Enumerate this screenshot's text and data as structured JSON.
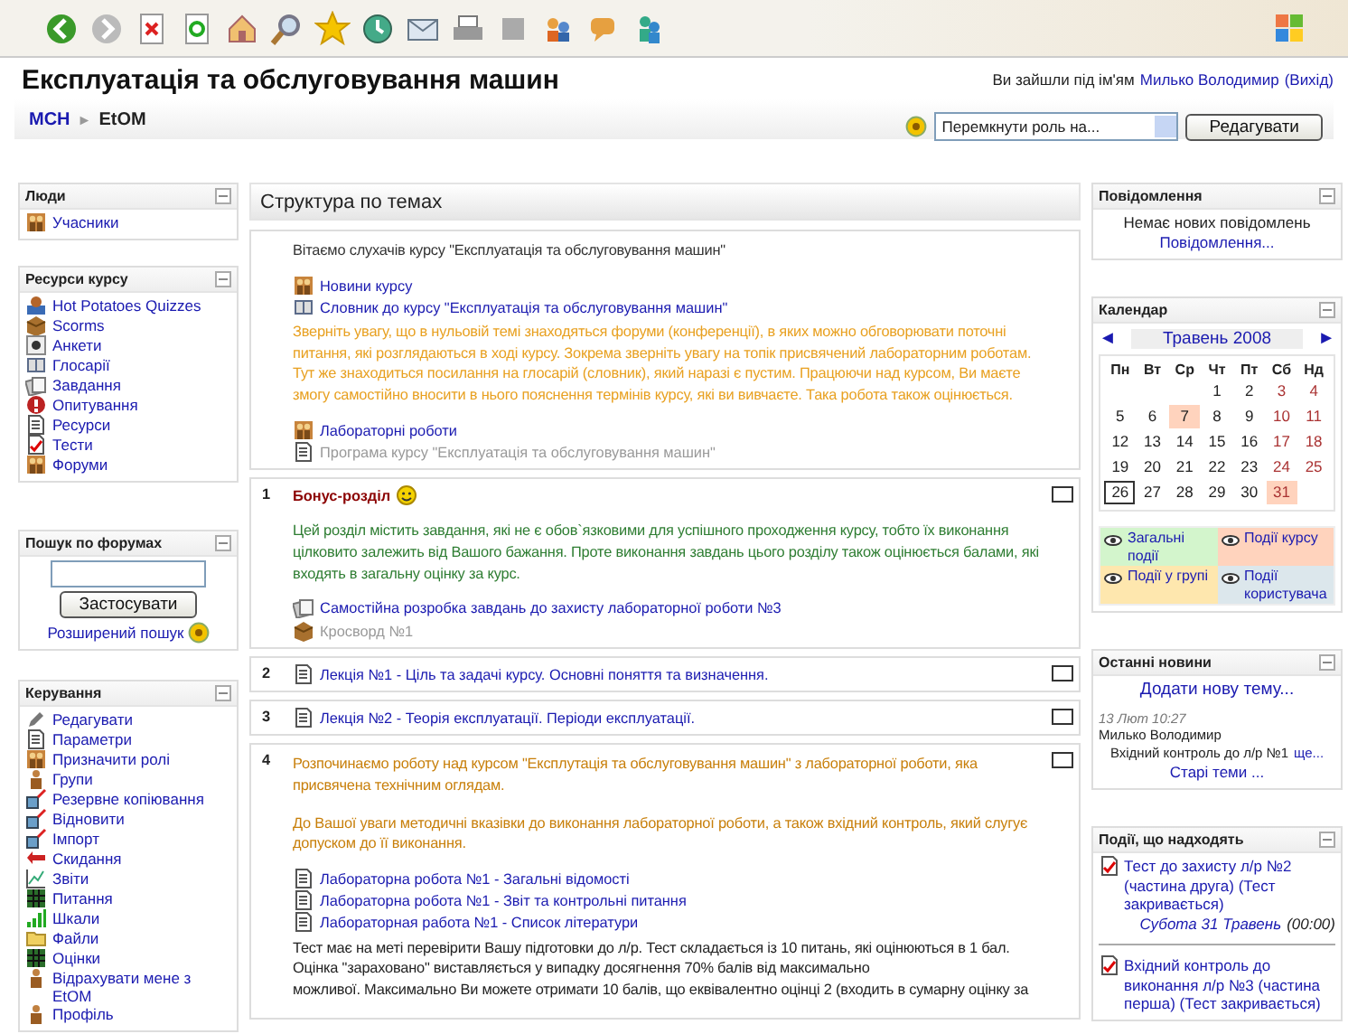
{
  "header": {
    "title": "Експлуатація та обслуговування машин",
    "login_text": "Ви зайшли під ім'ям",
    "user_link": "Милько Володимир",
    "logout_link": "(Вихід)"
  },
  "breadcrumb": {
    "items": [
      "МСН",
      "EtOM"
    ],
    "separator": "►"
  },
  "role_select": {
    "placeholder": "Перемкнути роль на..."
  },
  "edit_button": "Редагувати",
  "left_blocks": [
    {
      "title": "Люди",
      "kind": "links",
      "items": [
        {
          "label": "Учасники",
          "kind": "participants"
        }
      ]
    },
    {
      "title": "Ресурси курсу",
      "kind": "links",
      "items": [
        {
          "label": "Hot Potatoes Quizzes",
          "kind": "quiz"
        },
        {
          "label": "Scorms",
          "kind": "scorm"
        },
        {
          "label": "Анкети",
          "kind": "survey"
        },
        {
          "label": "Глосарії",
          "kind": "glossary"
        },
        {
          "label": "Завдання",
          "kind": "assignment"
        },
        {
          "label": "Опитування",
          "kind": "poll"
        },
        {
          "label": "Ресурси",
          "kind": "resource"
        },
        {
          "label": "Тести",
          "kind": "test"
        },
        {
          "label": "Форуми",
          "kind": "forum"
        }
      ]
    },
    {
      "title": "Пошук по форумах",
      "kind": "search",
      "button": "Застосувати",
      "link": "Розширений пошук"
    },
    {
      "title": "Керування",
      "kind": "links",
      "items": [
        {
          "label": "Редагувати",
          "kind": "edit"
        },
        {
          "label": "Параметри",
          "kind": "settings"
        },
        {
          "label": "Призначити ролі",
          "kind": "roles"
        },
        {
          "label": "Групи",
          "kind": "groups"
        },
        {
          "label": "Резервне копіювання",
          "kind": "backup"
        },
        {
          "label": "Відновити",
          "kind": "backup"
        },
        {
          "label": "Імпорт",
          "kind": "backup"
        },
        {
          "label": "Скидання",
          "kind": "reset"
        },
        {
          "label": "Звіти",
          "kind": "reports"
        },
        {
          "label": "Питання",
          "kind": "questions"
        },
        {
          "label": "Шкали",
          "kind": "scales"
        },
        {
          "label": "Файли",
          "kind": "files"
        },
        {
          "label": "Оцінки",
          "kind": "questions"
        },
        {
          "label": "Відрахувати мене з EtOM",
          "kind": "unenrol"
        },
        {
          "label": "Профіль",
          "kind": "unenrol"
        }
      ]
    }
  ],
  "center": {
    "title": "Структура по темах",
    "sections": [
      {
        "toggle": false,
        "content": [
          {
            "kind": "text",
            "color": "#333333",
            "text": "Вітаємо слухачів курсу \"Експлуатація та обслуговування машин\""
          },
          {
            "kind": "forum",
            "label": "Новини курсу",
            "dimmed": false
          },
          {
            "kind": "glossary",
            "label": "Словник до курсу \"Експлуатація та обслуговування машин\"",
            "dimmed": false
          },
          {
            "kind": "text",
            "color": "#e8a020",
            "text": "Зверніть увагу, що в нульовій темі знаходяться форуми (конференції), в яких можно обговорювати поточні питання, які розглядаються в ході курсу. Зокрема зверніть увагу на топік присвячений лабораторним роботам. Тут же знаходиться посилання на глосарій (словник), який наразі є пустим. Працюючи над курсом, Ви маєте змогу самостійно вносити в нього пояснення термінів курсу, які ви вивчаєте. Така робота також оцінюється."
          },
          {
            "kind": "forum",
            "label": "Лабораторні роботи",
            "dimmed": false
          },
          {
            "kind": "resource",
            "label": "Програма курсу \"Експлуатація та обслуговування машин\"",
            "dimmed": true
          }
        ]
      },
      {
        "number": "1",
        "toggle": true,
        "content": [
          {
            "kind": "title",
            "text": "Бонус-розділ"
          },
          {
            "kind": "text",
            "color": "#2e7d32",
            "text": "Цей розділ містить завдання, які не є обов`язковими для успішного проходження курсу, тобто їх виконання цілковито залежить від Вашого бажання. Проте виконання завдань цього розділу також оцінюється балами, які входять в загальну оцінку за курс."
          },
          {
            "kind": "assignment",
            "label": "Самостійна розробка завдань до захисту лабораторної роботи №3",
            "dimmed": false
          },
          {
            "kind": "scorm",
            "label": "Кросворд №1",
            "dimmed": true
          }
        ]
      },
      {
        "number": "2",
        "toggle": true,
        "content": [
          {
            "kind": "resource",
            "label": "Лекція №1 - Ціль та задачі курсу. Основні поняття та визначення.",
            "dimmed": false
          }
        ]
      },
      {
        "number": "3",
        "toggle": true,
        "content": [
          {
            "kind": "resource",
            "label": "Лекція №2 - Теорія експлуатації. Періоди експлуатації.",
            "dimmed": false
          }
        ]
      },
      {
        "number": "4",
        "toggle": true,
        "content": [
          {
            "kind": "text",
            "color": "#c87f0a",
            "text": "Розпочинаємо роботу над курсом \"Експлутація та обслуговування машин\" з лабораторної роботи, яка присвячена технічним оглядам."
          },
          {
            "kind": "text",
            "color": "#c87f0a",
            "text": "До Вашої уваги методичні вказівки до виконання лабораторної роботи, а також вхідний контроль, який слугує допуском до її виконання."
          },
          {
            "kind": "resource",
            "label": "Лабораторна робота №1 - Загальні відомості",
            "dimmed": false
          },
          {
            "kind": "resource",
            "label": "Лабораторна робота №1 - Звіт та контрольні питання",
            "dimmed": false
          },
          {
            "kind": "resource",
            "label": "Лабораторная работа №1 - Список літератури",
            "dimmed": false
          },
          {
            "kind": "text",
            "color": "#222222",
            "text": "Тест має на меті перевірити Вашу підготовки до л/р. Тест складається із 10 питань, які оцінюються в 1 бал. Оцінка \"зараховано\" виставляється у випадку досягнення 70% балів від максимально\nможливої. Максимально Ви можете отримати 10 балів, що еквівалентно оцінці 2 (входить в сумарну оцінку за"
          }
        ]
      }
    ]
  },
  "messages": {
    "title": "Повідомлення",
    "text": "Немає нових повідомлень",
    "link": "Повідомлення..."
  },
  "calendar": {
    "title": "Календар",
    "prev": "◄",
    "next": "►",
    "month": "Травень 2008",
    "weekdays": [
      "Пн",
      "Вт",
      "Ср",
      "Чт",
      "Пт",
      "Сб",
      "Нд"
    ],
    "weeks": [
      [
        {
          "day": "1",
          "event": false,
          "today": false
        },
        {
          "day": "2",
          "event": false,
          "today": false
        },
        {
          "day": "3",
          "event": false,
          "today": false
        },
        {
          "day": "4",
          "event": false,
          "today": false
        }
      ],
      [
        {
          "day": "5",
          "event": false,
          "today": false
        },
        {
          "day": "6",
          "event": false,
          "today": false
        },
        {
          "day": "7",
          "event": true,
          "today": false
        },
        {
          "day": "8",
          "event": false,
          "today": false
        },
        {
          "day": "9",
          "event": false,
          "today": false
        },
        {
          "day": "10",
          "event": false,
          "today": false
        },
        {
          "day": "11",
          "event": false,
          "today": false
        }
      ],
      [
        {
          "day": "12",
          "event": false,
          "today": false
        },
        {
          "day": "13",
          "event": false,
          "today": false
        },
        {
          "day": "14",
          "event": false,
          "today": false
        },
        {
          "day": "15",
          "event": false,
          "today": false
        },
        {
          "day": "16",
          "event": false,
          "today": false
        },
        {
          "day": "17",
          "event": false,
          "today": false
        },
        {
          "day": "18",
          "event": false,
          "today": false
        }
      ],
      [
        {
          "day": "19",
          "event": false,
          "today": false
        },
        {
          "day": "20",
          "event": false,
          "today": false
        },
        {
          "day": "21",
          "event": false,
          "today": false
        },
        {
          "day": "22",
          "event": false,
          "today": false
        },
        {
          "day": "23",
          "event": false,
          "today": false
        },
        {
          "day": "24",
          "event": false,
          "today": false
        },
        {
          "day": "25",
          "event": false,
          "today": false
        }
      ],
      [
        {
          "day": "26",
          "event": false,
          "today": true
        },
        {
          "day": "27",
          "event": false,
          "today": false
        },
        {
          "day": "28",
          "event": false,
          "today": false
        },
        {
          "day": "29",
          "event": false,
          "today": false
        },
        {
          "day": "30",
          "event": false,
          "today": false
        },
        {
          "day": "31",
          "event": true,
          "today": false
        }
      ]
    ],
    "legend": [
      {
        "label": "Загальні події",
        "color": "#d3f5cc"
      },
      {
        "label": "Події курсу",
        "color": "#ffd3bd"
      },
      {
        "label": "Події у групі",
        "color": "#fee7ae"
      },
      {
        "label": "Події користувача",
        "color": "#dce7ec"
      }
    ]
  },
  "news": {
    "title": "Останні новини",
    "add_link": "Додати нову тему...",
    "date": "13 Лют 10:27",
    "author": "Милько Володимир",
    "headline": "Вхідний контроль до л/р №1",
    "more_link": "ще...",
    "older_link": "Старі теми ..."
  },
  "upcoming": {
    "title": "Події, що надходять",
    "events": [
      {
        "title": "Тест до захисту л/р №2 (частина друга) (Тест закривається)",
        "date": "Субота 31 Травень",
        "time": "(00:00)"
      },
      {
        "title": "Вхідний контроль до виконання л/р №3 (частина перша) (Тест закривається)"
      }
    ]
  }
}
